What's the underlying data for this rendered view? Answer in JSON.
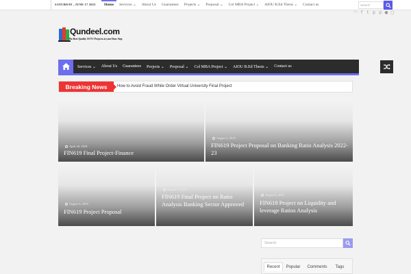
{
  "topbar": {
    "date": "SATURDAY , JUNE 17 2023",
    "nav": [
      {
        "label": "Home",
        "active": true
      },
      {
        "label": "Services"
      },
      {
        "label": "About Us"
      },
      {
        "label": "Guarantees"
      },
      {
        "label": "Projects"
      },
      {
        "label": "Proposal"
      },
      {
        "label": "Col MBA Project"
      },
      {
        "label": "AIOU B.Ed Thesis"
      },
      {
        "label": "Contact us"
      }
    ],
    "search_placeholder": "Search"
  },
  "social_icons": [
    "rss-icon",
    "facebook-icon",
    "twitter-icon",
    "pinterest-icon",
    "dribbble-icon",
    "flickr-icon",
    "instagram-icon"
  ],
  "logo": {
    "name": "Qundeel.com",
    "tagline": "The Best Quality Of VU Projects at your Door Step"
  },
  "mainnav": {
    "items": [
      "Services",
      "About Us",
      "Guarantees",
      "Projects",
      "Proposal",
      "Col MBA Project",
      "AIOU B.Ed Thesis",
      "Contact us"
    ],
    "accent": "#6d6df0"
  },
  "breaking": {
    "label": "Breaking News",
    "text": "How to Avoid Fraud While Order Virtual University Final Project",
    "color": "#ee3333"
  },
  "tiles": [
    {
      "date": "April 26, 2018",
      "title": "FIN619 Final Project-Finance"
    },
    {
      "date": "August 2, 2018",
      "title": "FIN619 Project Proposal on Banking Ratio Analysis 2022-23"
    },
    {
      "date": "August 2, 2018",
      "title": "FIN619 Project Proposal"
    },
    {
      "date": "August 2, 2018",
      "title": "FIN619 Final Project on Ratio Analysis Banking Sector Approved"
    },
    {
      "date": "August 2, 2018",
      "title": "FIN619 Project on Liquidity and leverage Ratios Analysis"
    }
  ],
  "sidebar": {
    "search_placeholder": "Search",
    "tabs": [
      "Recent",
      "Popular",
      "Comments",
      "Tags"
    ]
  }
}
